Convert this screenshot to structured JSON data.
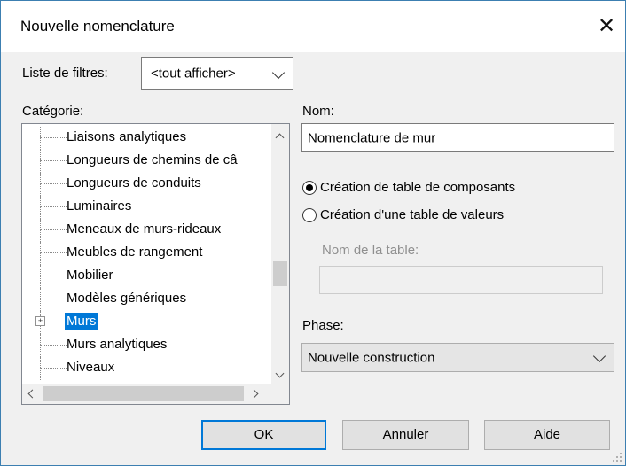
{
  "dialog": {
    "title": "Nouvelle nomenclature"
  },
  "filter": {
    "label": "Liste de filtres:",
    "value": "<tout afficher>"
  },
  "category": {
    "label": "Catégorie:",
    "items": [
      {
        "label": "Liaisons analytiques"
      },
      {
        "label": "Longueurs de chemins de câ"
      },
      {
        "label": "Longueurs de conduits"
      },
      {
        "label": "Luminaires"
      },
      {
        "label": "Meneaux de murs-rideaux"
      },
      {
        "label": "Meubles de rangement"
      },
      {
        "label": "Mobilier"
      },
      {
        "label": "Modèles génériques"
      },
      {
        "label": "Murs",
        "selected": true,
        "expander": "+"
      },
      {
        "label": "Murs analytiques"
      },
      {
        "label": "Niveaux"
      }
    ]
  },
  "name": {
    "label": "Nom:",
    "value": "Nomenclature de mur"
  },
  "schedule_type": {
    "option1": "Création de table de composants",
    "option2": "Création d'une table de valeurs",
    "selected": "option1"
  },
  "table_name": {
    "label": "Nom de la table:",
    "value": ""
  },
  "phase": {
    "label": "Phase:",
    "value": "Nouvelle construction"
  },
  "buttons": {
    "ok": "OK",
    "cancel": "Annuler",
    "help": "Aide"
  }
}
